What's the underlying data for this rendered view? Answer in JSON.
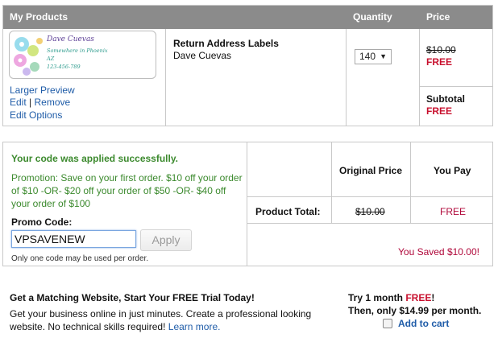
{
  "cart": {
    "header": {
      "products": "My Products",
      "quantity": "Quantity",
      "price": "Price"
    },
    "item": {
      "thumb": {
        "name": "Dave Cuevas",
        "line1": "Somewhere in Phoenix",
        "line2": "AZ",
        "line3": "123-456-789"
      },
      "links": {
        "larger_preview": "Larger Preview",
        "edit": "Edit",
        "separator": "|",
        "remove": "Remove",
        "edit_options": "Edit Options"
      },
      "product_name": "Return Address Labels",
      "customer_name": "Dave Cuevas",
      "quantity": "140",
      "original_price": "$10.00",
      "price": "FREE",
      "subtotal_label": "Subtotal",
      "subtotal": "FREE"
    }
  },
  "promo": {
    "success": "Your code was applied successfully.",
    "description": "Promotion: Save on your first order. $10 off your order of $10 -OR- $20 off your order of $50 -OR- $40 off your order of $100",
    "code_label": "Promo Code:",
    "code_value": "VPSAVENEW",
    "apply_label": "Apply",
    "note": "Only one code may be used per order.",
    "table": {
      "original_price_header": "Original Price",
      "you_pay_header": "You Pay",
      "row_label": "Product Total:",
      "original_total": "$10.00",
      "you_pay": "FREE"
    },
    "saved": "You Saved $10.00!"
  },
  "upsell": {
    "title": "Get a Matching Website, Start Your FREE Trial Today!",
    "description": "Get your business online in just minutes. Create a professional looking website. No technical skills required!",
    "learn_more": "Learn more.",
    "try_prefix": "Try 1 month ",
    "try_free": "FREE",
    "try_suffix": "!",
    "then": "Then, only $14.99 per month.",
    "add_to_cart": "Add to cart"
  },
  "colors": {
    "header_bg": "#8b8b8b",
    "link": "#1f5ca8",
    "red": "#c8102e",
    "green": "#3c8a2e",
    "saved": "#b0083a"
  }
}
